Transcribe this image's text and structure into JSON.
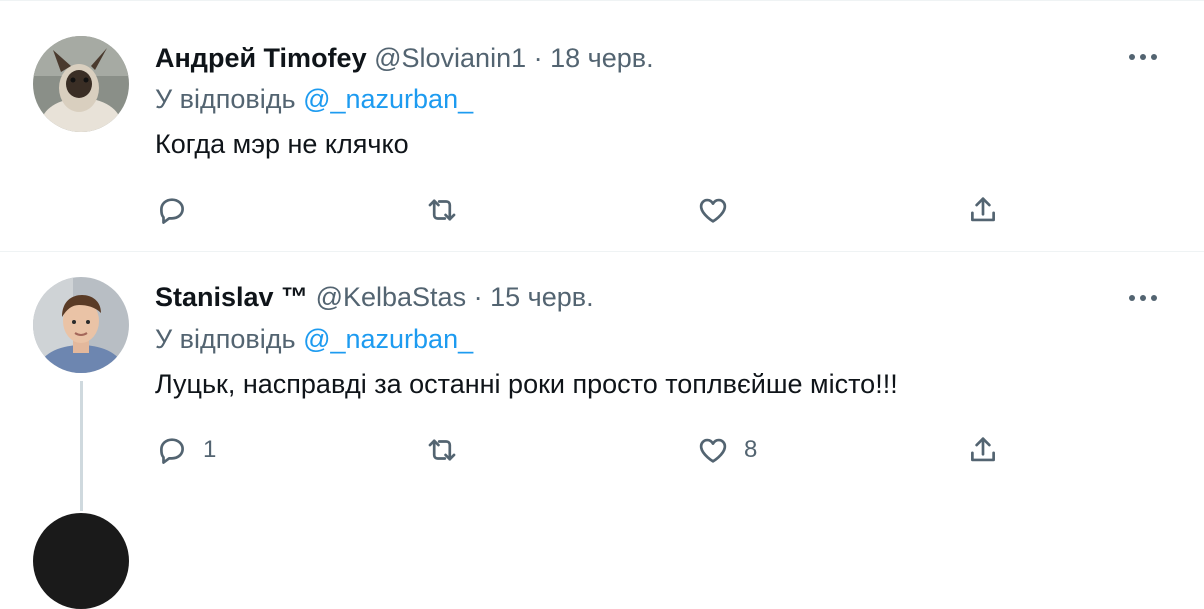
{
  "tweets": [
    {
      "name": "Андрей Timofey",
      "handle": "@Slovianin1",
      "separator": "·",
      "date": "18 черв.",
      "reply_prefix": "У відповідь",
      "reply_to": "@_nazurban_",
      "text": "Когда мэр не клячко",
      "replies": "",
      "retweets": "",
      "likes": ""
    },
    {
      "name": "Stanislav ™",
      "handle": "@KelbaStas",
      "separator": "·",
      "date": "15 черв.",
      "reply_prefix": "У відповідь",
      "reply_to": "@_nazurban_",
      "text": "Луцьк, насправді за останні роки просто топлвєйше місто!!!",
      "replies": "1",
      "retweets": "",
      "likes": "8"
    }
  ],
  "icons": {
    "more": "more-horizontal-icon",
    "reply": "reply-bubble-icon",
    "retweet": "retweet-icon",
    "like": "heart-icon",
    "share": "share-upload-icon"
  },
  "colors": {
    "link": "#1d9bf0",
    "secondary_text": "#536471",
    "thread_line": "#cfd9de",
    "divider": "#eff3f4"
  }
}
